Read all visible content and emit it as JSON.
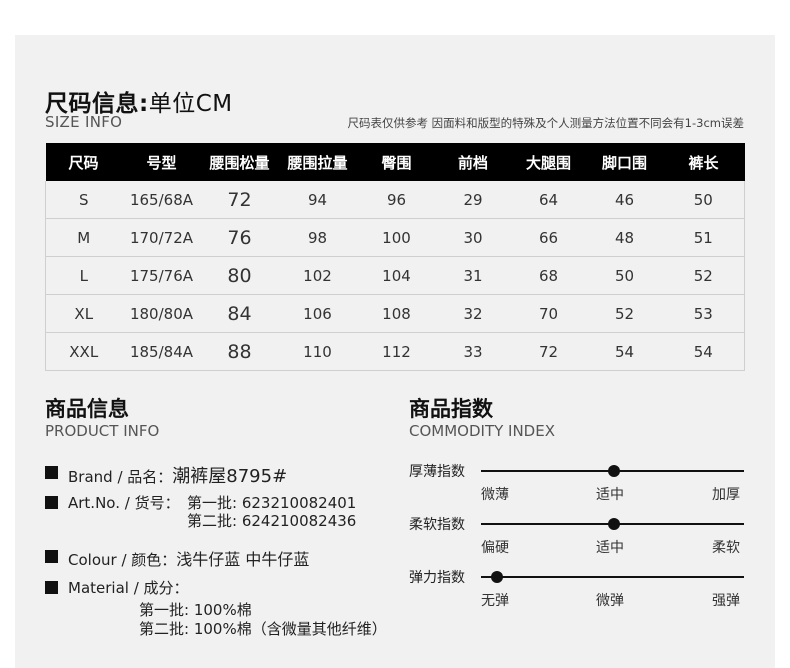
{
  "size_info": {
    "title": "尺码信息:",
    "unit": "单位CM",
    "subtitle": "SIZE INFO",
    "note": "尺码表仅供参考 因面料和版型的特殊及个人测量方法位置不同会有1-3cm误差"
  },
  "size_table": {
    "headers": [
      "尺码",
      "号型",
      "腰围松量",
      "腰围拉量",
      "臀围",
      "前档",
      "大腿围",
      "脚口围",
      "裤长"
    ],
    "rows": [
      [
        "S",
        "165/68A",
        "72",
        "94",
        "96",
        "29",
        "64",
        "46",
        "50"
      ],
      [
        "M",
        "170/72A",
        "76",
        "98",
        "100",
        "30",
        "66",
        "48",
        "51"
      ],
      [
        "L",
        "175/76A",
        "80",
        "102",
        "104",
        "31",
        "68",
        "50",
        "52"
      ],
      [
        "XL",
        "180/80A",
        "84",
        "106",
        "108",
        "32",
        "70",
        "52",
        "53"
      ],
      [
        "XXL",
        "185/84A",
        "88",
        "110",
        "112",
        "33",
        "72",
        "54",
        "54"
      ]
    ]
  },
  "product_info": {
    "title": "商品信息",
    "subtitle": "PRODUCT INFO",
    "brand_label": "Brand / 品名：",
    "brand_value": "潮裤屋8795#",
    "artno_label": "Art.No. / 货号：",
    "artno_batch1": "第一批:  623210082401",
    "artno_batch2": "第二批:  624210082436",
    "colour_label": "Colour / 颜色：",
    "colour_value": "浅牛仔蓝 中牛仔蓝",
    "material_label": "Material / 成分：",
    "material_batch1": "第一批:  100%棉",
    "material_batch2": "第二批:  100%棉（含微量其他纤维）"
  },
  "commodity_index": {
    "title": "商品指数",
    "subtitle": "COMMODITY INDEX",
    "scales": [
      {
        "label": "厚薄指数",
        "ticks": [
          "微薄",
          "适中",
          "加厚"
        ],
        "level": 0.5
      },
      {
        "label": "柔软指数",
        "ticks": [
          "偏硬",
          "适中",
          "柔软"
        ],
        "level": 0.5
      },
      {
        "label": "弹力指数",
        "ticks": [
          "无弹",
          "微弹",
          "强弹"
        ],
        "level": 0.0
      }
    ]
  }
}
